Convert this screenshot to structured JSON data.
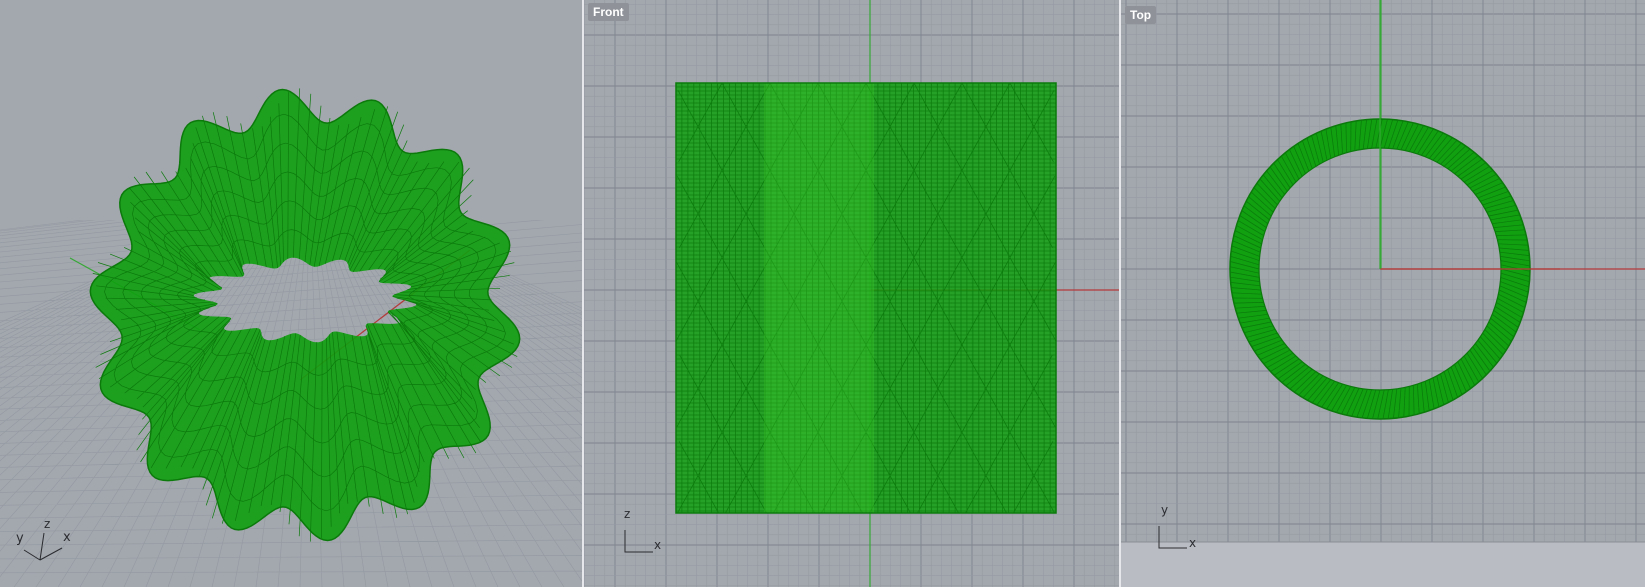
{
  "viewports": [
    {
      "id": "perspective",
      "label": "",
      "axes": {
        "x": "x",
        "y": "y",
        "z": "z"
      }
    },
    {
      "id": "front",
      "label": "Front",
      "axes": {
        "x": "x",
        "z": "z"
      }
    },
    {
      "id": "top",
      "label": "Top",
      "axes": {
        "x": "x",
        "y": "y"
      }
    }
  ],
  "colors": {
    "background": "#a3a7ae",
    "grid_minor": "#949aa2",
    "grid_major": "#7f858e",
    "mesh": "#10a010",
    "mesh_light": "#3fcf2f",
    "x_axis": "#b43a3a",
    "y_axis": "#36a836"
  }
}
